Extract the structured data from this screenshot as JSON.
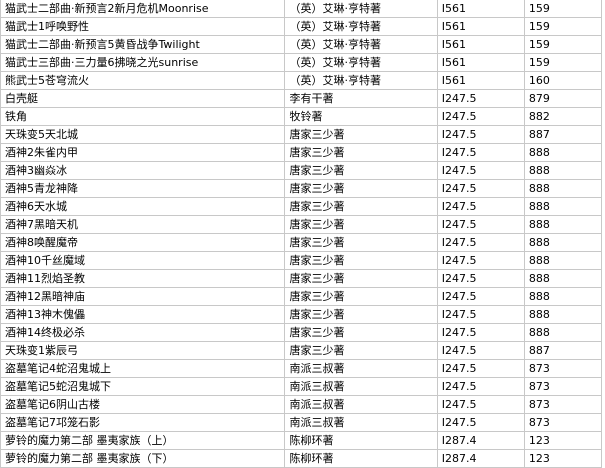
{
  "table": {
    "rows": [
      {
        "title": "猫武士二部曲·新预言2新月危机Moonrise",
        "author": "（英）艾琳·亨特著",
        "call": "I561",
        "pages": "159"
      },
      {
        "title": "猫武士1呼唤野性",
        "author": "（英）艾琳·亨特著",
        "call": "I561",
        "pages": "159"
      },
      {
        "title": "猫武士二部曲·新预言5黄昏战争Twilight",
        "author": "（英）艾琳·亨特著",
        "call": "I561",
        "pages": "159"
      },
      {
        "title": "猫武士三部曲·三力量6拂晓之光sunrise",
        "author": "（英）艾琳·亨特著",
        "call": "I561",
        "pages": "159"
      },
      {
        "title": "熊武士5苍穹流火",
        "author": "（英）艾琳·亨特著",
        "call": "I561",
        "pages": "160"
      },
      {
        "title": "白壳艇",
        "author": "李有干著",
        "call": "I247.5",
        "pages": "879"
      },
      {
        "title": "铁角",
        "author": "牧铃著",
        "call": "I247.5",
        "pages": "882"
      },
      {
        "title": "天珠变5天北城",
        "author": "唐家三少著",
        "call": "I247.5",
        "pages": "887"
      },
      {
        "title": "酒神2朱雀内甲",
        "author": "唐家三少著",
        "call": "I247.5",
        "pages": "888"
      },
      {
        "title": "酒神3幽焱冰",
        "author": "唐家三少著",
        "call": "I247.5",
        "pages": "888"
      },
      {
        "title": "酒神5青龙神降",
        "author": "唐家三少著",
        "call": "I247.5",
        "pages": "888"
      },
      {
        "title": "酒神6天水城",
        "author": "唐家三少著",
        "call": "I247.5",
        "pages": "888"
      },
      {
        "title": "酒神7黑暗天机",
        "author": "唐家三少著",
        "call": "I247.5",
        "pages": "888"
      },
      {
        "title": "酒神8唤醒魔帝",
        "author": "唐家三少著",
        "call": "I247.5",
        "pages": "888"
      },
      {
        "title": "酒神10千丝魔域",
        "author": "唐家三少著",
        "call": "I247.5",
        "pages": "888"
      },
      {
        "title": "酒神11烈焰圣教",
        "author": "唐家三少著",
        "call": "I247.5",
        "pages": "888"
      },
      {
        "title": "酒神12黑暗神庙",
        "author": "唐家三少著",
        "call": "I247.5",
        "pages": "888"
      },
      {
        "title": "酒神13神木傀儡",
        "author": "唐家三少著",
        "call": "I247.5",
        "pages": "888"
      },
      {
        "title": "酒神14终极必杀",
        "author": "唐家三少著",
        "call": "I247.5",
        "pages": "888"
      },
      {
        "title": "天珠变1紫辰弓",
        "author": "唐家三少著",
        "call": "I247.5",
        "pages": "887"
      },
      {
        "title": "盗墓笔记4蛇沼鬼城上",
        "author": "南派三叔著",
        "call": "I247.5",
        "pages": "873"
      },
      {
        "title": "盗墓笔记5蛇沼鬼城下",
        "author": "南派三叔著",
        "call": "I247.5",
        "pages": "873"
      },
      {
        "title": "盗墓笔记6阴山古楼",
        "author": "南派三叔著",
        "call": "I247.5",
        "pages": "873"
      },
      {
        "title": "盗墓笔记7邛笼石影",
        "author": "南派三叔著",
        "call": "I247.5",
        "pages": "873"
      },
      {
        "title": "萝铃的魔力第二部 墨夷家族（上）",
        "author": "陈柳环著",
        "call": "I287.4",
        "pages": "123"
      },
      {
        "title": "萝铃的魔力第二部 墨夷家族（下）",
        "author": "陈柳环著",
        "call": "I287.4",
        "pages": "123"
      }
    ]
  }
}
